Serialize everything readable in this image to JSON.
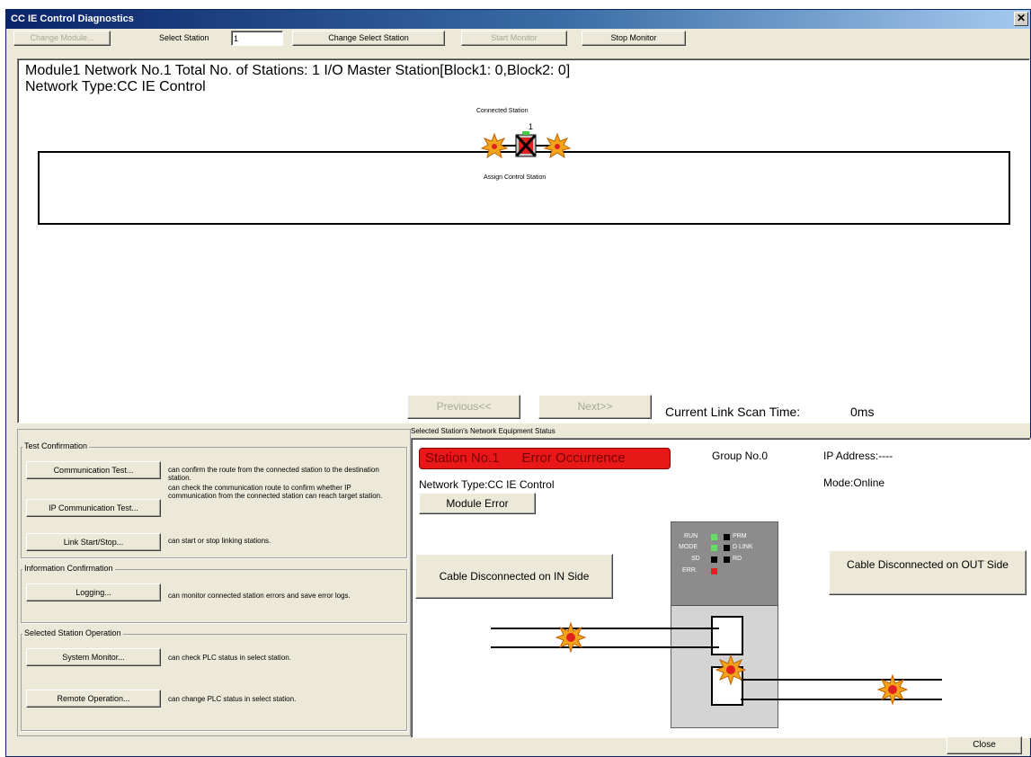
{
  "window": {
    "title": "CC IE Control Diagnostics",
    "close_glyph": "✕"
  },
  "toolbar": {
    "change_module": "Change Module...",
    "select_station_label": "Select Station",
    "select_station_value": "1",
    "change_select_station": "Change Select Station",
    "start_monitor": "Start Monitor",
    "stop_monitor": "Stop Monitor"
  },
  "network_view": {
    "info_line1": "Module1  Network No.1  Total No. of Stations:  1  I/O Master Station[Block1:  0,Block2:  0]",
    "info_line2": "Network Type:CC IE Control",
    "connected_station_label": "Connected Station",
    "station_number": "1",
    "assign_control_station_label": "Assign Control Station",
    "previous_button": "Previous<<",
    "next_button": "Next>>",
    "link_scan_label": "Current Link Scan Time:",
    "link_scan_value": "0ms"
  },
  "test_confirmation": {
    "title": "Test Confirmation",
    "items": [
      {
        "button": "Communication Test...",
        "description": "can confirm the route from the connected station to the destination station."
      },
      {
        "button": "IP Communication Test...",
        "description": "can check the communication route to confirm whether IP communication from the connected station can reach target station."
      },
      {
        "button": "Link Start/Stop...",
        "description": "can start or stop linking stations."
      }
    ]
  },
  "information_confirmation": {
    "title": "Information Confirmation",
    "items": [
      {
        "button": "Logging...",
        "description": "can monitor connected station errors and save error logs."
      }
    ]
  },
  "selected_station_operation": {
    "title": "Selected Station Operation",
    "items": [
      {
        "button": "System Monitor...",
        "description": "can check PLC status in select station."
      },
      {
        "button": "Remote Operation...",
        "description": "can change PLC status in select station."
      }
    ]
  },
  "equipment_status": {
    "title": "Selected Station's Network Equipment Status",
    "station_banner": "Station No.1      Error Occurrence",
    "group": "Group No.0",
    "ip_address": "IP Address:----",
    "mode": "Mode:Online",
    "network_type": "Network Type:CC IE Control",
    "module_error_button": "Module Error",
    "cable_in_button": "Cable Disconnected on IN Side",
    "cable_out_button": "Cable Disconnected on OUT Side",
    "leds": [
      {
        "label": "RUN",
        "color": "#66dd66"
      },
      {
        "label": "PRM",
        "color": "#000000"
      },
      {
        "label": "MODE",
        "color": "#66dd66"
      },
      {
        "label": "D LINK",
        "color": "#000000"
      },
      {
        "label": "SD",
        "color": "#000000"
      },
      {
        "label": "RD",
        "color": "#000000"
      },
      {
        "label": "ERR.",
        "color": "#e02020"
      }
    ]
  },
  "footer": {
    "close_button": "Close"
  },
  "colors": {
    "error_red": "#e81818",
    "title_blue": "#0a246a",
    "dialog_bg": "#ece9d8"
  }
}
